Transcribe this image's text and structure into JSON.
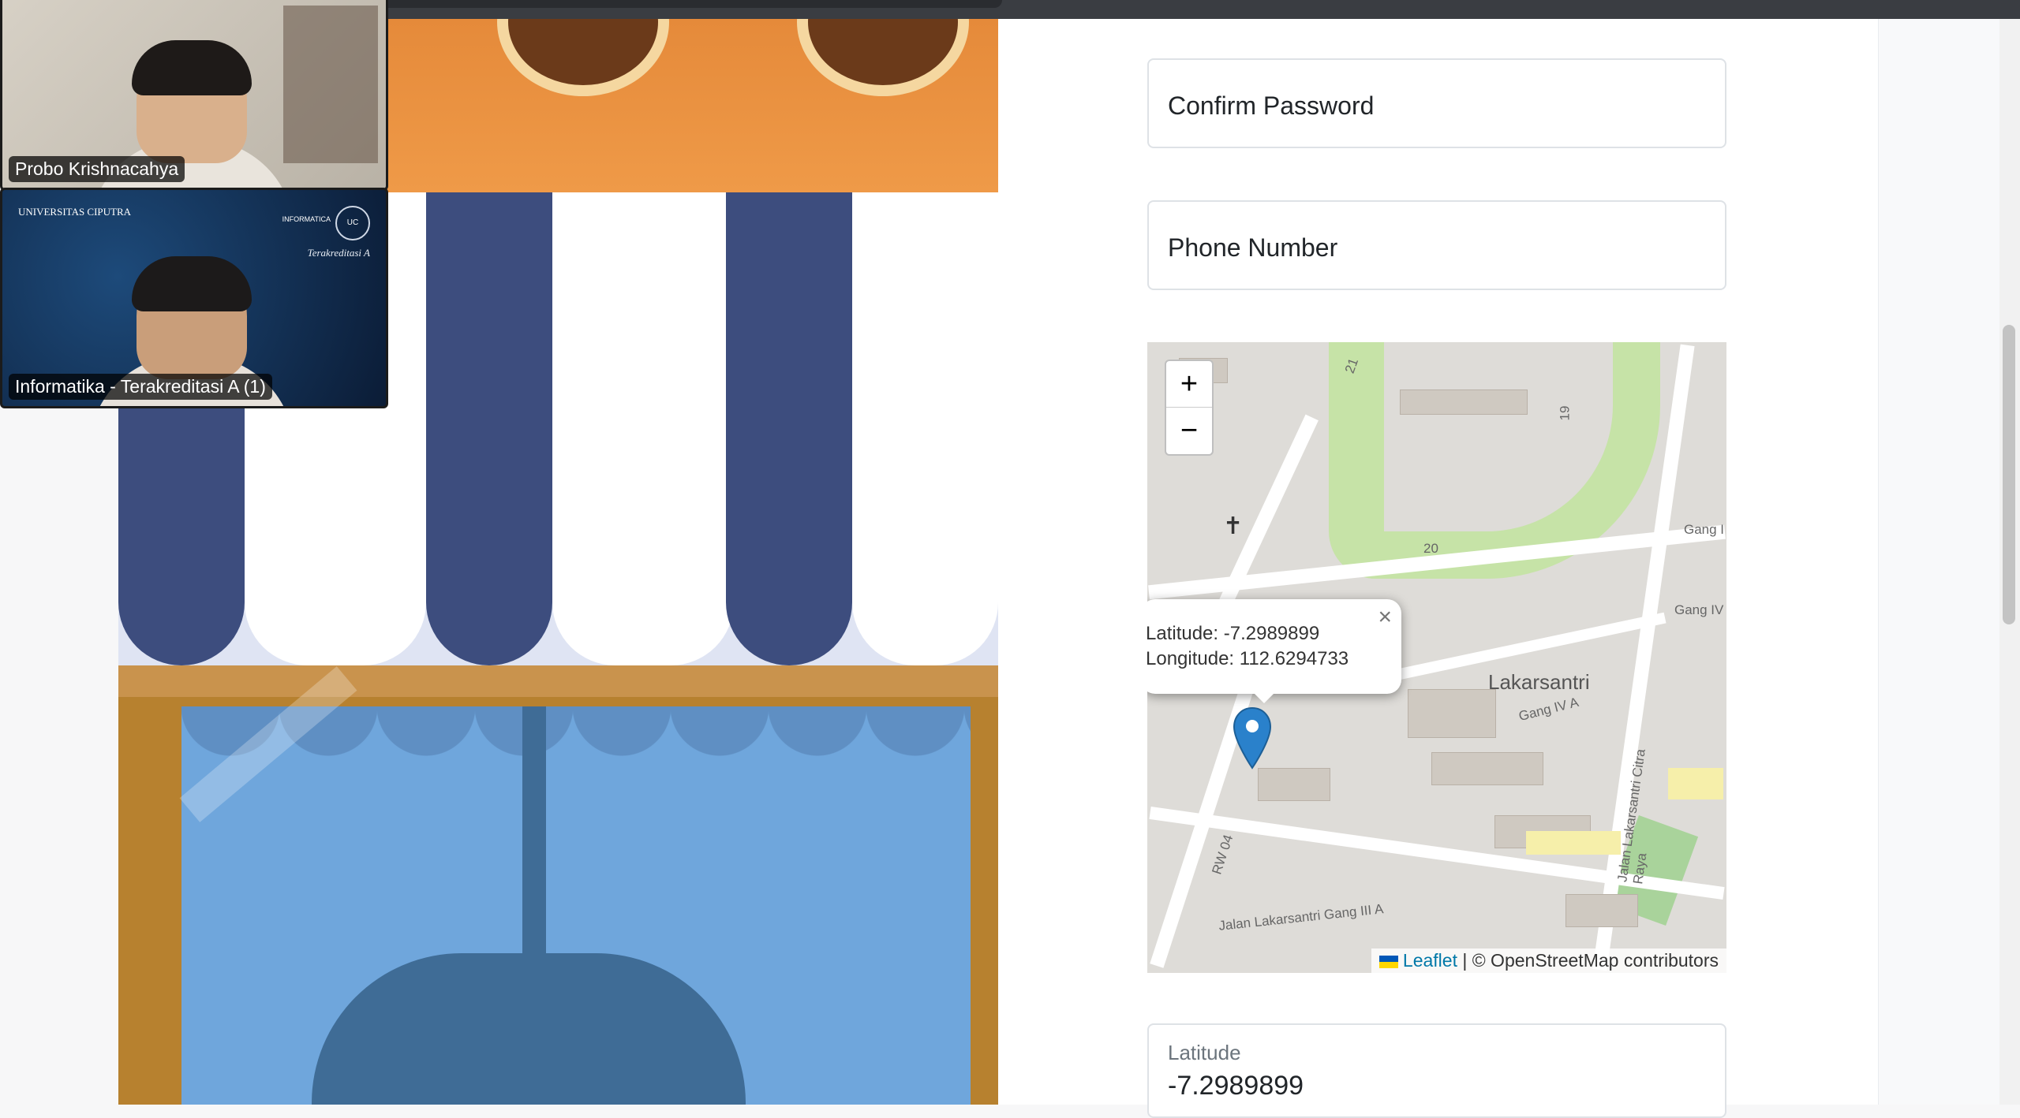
{
  "participants": [
    {
      "name": "Probo Krishnacahya"
    },
    {
      "name": "Informatika - Terakreditasi A (1)"
    }
  ],
  "tile2_logos": {
    "left": "UNIVERSITAS CIPUTRA",
    "right": "INFORMATICA",
    "tag": "Terakreditasi A"
  },
  "form": {
    "confirm_password_placeholder": "Confirm Password",
    "phone_number_placeholder": "Phone Number",
    "latitude_label": "Latitude",
    "latitude_value": "-7.2989899"
  },
  "map": {
    "zoom_in": "+",
    "zoom_out": "−",
    "popup_latitude": "Latitude: -7.2989899",
    "popup_longitude": "Longitude: 112.6294733",
    "popup_close": "×",
    "area_label": "Lakarsantri",
    "street_labels": [
      "Gang IV A",
      "Gang I",
      "Gang IV",
      "Jalan Lakarsantri Gang III A",
      "Jalan Lakarsantri Citra Raya",
      "RW 04",
      "20",
      "19",
      "21"
    ],
    "attribution_link": "Leaflet",
    "attribution_text": "| © OpenStreetMap contributors",
    "marker_color": "#2a81cb"
  }
}
